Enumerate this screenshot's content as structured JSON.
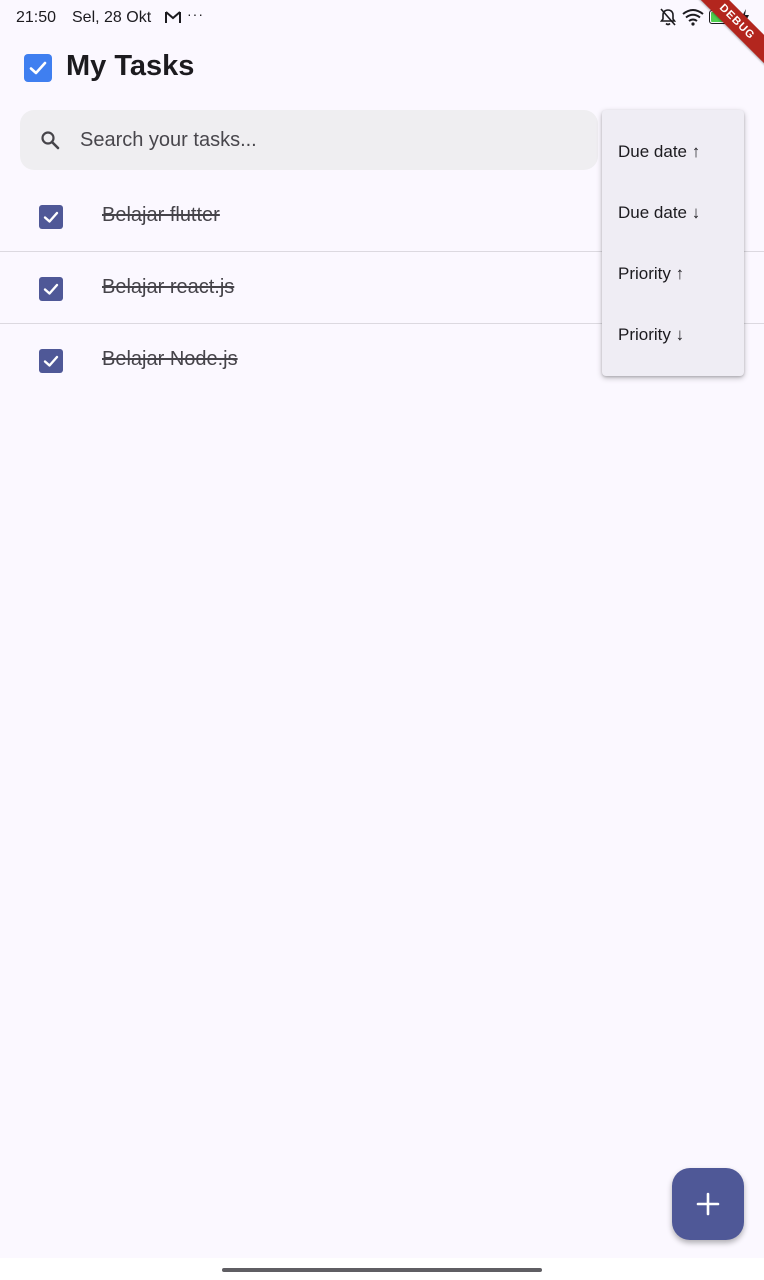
{
  "status_bar": {
    "time": "21:50",
    "date": "Sel, 28 Okt",
    "more": "···",
    "battery": "92",
    "icons": [
      "gmail-icon",
      "bell-off-icon",
      "wifi-icon",
      "battery-icon",
      "charging-bolt-icon"
    ]
  },
  "debug_banner": "DEBUG",
  "header": {
    "title": "My Tasks",
    "logo_icon": "checkbox-logo-icon"
  },
  "search": {
    "placeholder": "Search your tasks...",
    "value": ""
  },
  "tasks": [
    {
      "title": "Belajar flutter",
      "completed": true
    },
    {
      "title": "Belajar react.js",
      "completed": true
    },
    {
      "title": "Belajar Node.js",
      "completed": true
    }
  ],
  "sort_menu": {
    "items": [
      "Due date ↑",
      "Due date ↓",
      "Priority ↑",
      "Priority ↓"
    ]
  },
  "fab": {
    "icon": "plus-icon"
  },
  "colors": {
    "primary": "#4f5897",
    "logo": "#3f7ff0",
    "background": "#fbf8ff",
    "debug": "#b3261e"
  }
}
